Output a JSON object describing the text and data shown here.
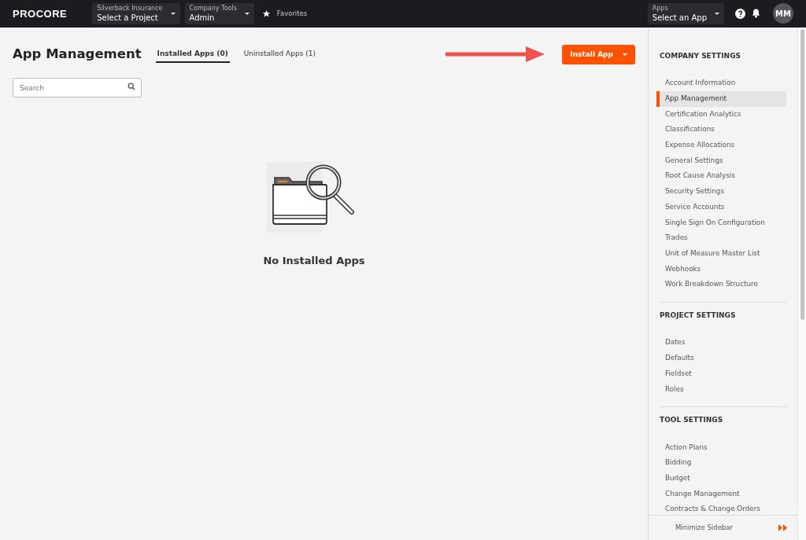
{
  "navbar": {
    "logo": "PROCORE",
    "pickers": [
      {
        "label": "Silverback Insurance",
        "value": "Select a Project"
      },
      {
        "label": "Company Tools",
        "value": "Admin"
      }
    ],
    "favorites": "Favorites",
    "apps_picker": {
      "label": "Apps",
      "value": "Select an App"
    },
    "avatar": "MM"
  },
  "page": {
    "title": "App Management",
    "tabs": [
      {
        "label": "Installed Apps (0)",
        "selected": true
      },
      {
        "label": "Uninstalled Apps (1)",
        "selected": false
      }
    ],
    "install_button": "Install App",
    "search": {
      "placeholder": "Search"
    },
    "empty_message": "No Installed Apps"
  },
  "sidebar": {
    "sections": [
      {
        "title": "COMPANY SETTINGS",
        "items": [
          {
            "label": "Account Information",
            "selected": false
          },
          {
            "label": "App Management",
            "selected": true
          },
          {
            "label": "Certification Analytics",
            "selected": false
          },
          {
            "label": "Classifications",
            "selected": false
          },
          {
            "label": "Expense Allocations",
            "selected": false
          },
          {
            "label": "General Settings",
            "selected": false
          },
          {
            "label": "Root Cause Analysis",
            "selected": false
          },
          {
            "label": "Security Settings",
            "selected": false
          },
          {
            "label": "Service Accounts",
            "selected": false
          },
          {
            "label": "Single Sign On Configuration",
            "selected": false
          },
          {
            "label": "Trades",
            "selected": false
          },
          {
            "label": "Unit of Measure Master List",
            "selected": false
          },
          {
            "label": "Webhooks",
            "selected": false
          },
          {
            "label": "Work Breakdown Structure",
            "selected": false
          }
        ]
      },
      {
        "title": "PROJECT SETTINGS",
        "items": [
          {
            "label": "Dates",
            "selected": false
          },
          {
            "label": "Defaults",
            "selected": false
          },
          {
            "label": "Fieldset",
            "selected": false
          },
          {
            "label": "Roles",
            "selected": false
          }
        ]
      },
      {
        "title": "TOOL SETTINGS",
        "items": [
          {
            "label": "Action Plans",
            "selected": false
          },
          {
            "label": "Bidding",
            "selected": false
          },
          {
            "label": "Budget",
            "selected": false
          },
          {
            "label": "Change Management",
            "selected": false
          },
          {
            "label": "Contracts & Change Orders",
            "selected": false
          }
        ]
      }
    ],
    "minimize": "Minimize Sidebar"
  }
}
